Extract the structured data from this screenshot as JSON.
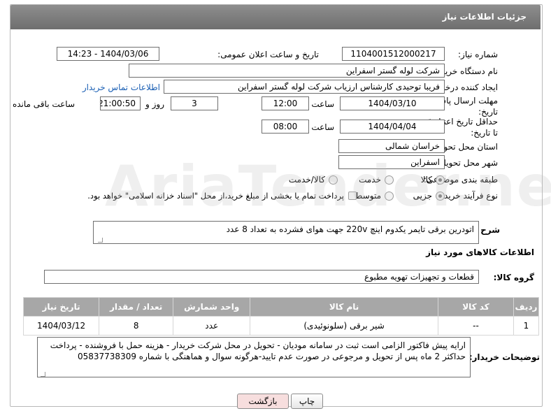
{
  "header": {
    "title": "جزئیات اطلاعات نیاز"
  },
  "form": {
    "need_number_label": "شماره نیاز:",
    "need_number": "1104001512000217",
    "announce_label": "تاریخ و ساعت اعلان عمومی:",
    "announce_value": "1404/03/06 - 14:23",
    "buyer_org_label": "نام دستگاه خریدار:",
    "buyer_org": "شرکت لوله گستر اسفراین",
    "creator_label": "ایجاد کننده درخواست:",
    "creator": "فریبا توحیدی کارشناس ارزیاب شرکت لوله گستر اسفراین",
    "contact_link": "اطلاعات تماس خریدار",
    "deadline_label_1": "مهلت ارسال پاسخ: تا",
    "deadline_label_2": "تاریخ:",
    "deadline_date": "1404/03/10",
    "time_label": "ساعت",
    "deadline_time": "12:00",
    "days_value": "3",
    "days_label": "روز و",
    "remaining_time": "21:00:50",
    "remaining_label": "ساعت باقی مانده",
    "min_validity_label_1": "حداقل تاریخ اعتبار قیمت:",
    "min_validity_label_2": "تا تاریخ:",
    "validity_date": "1404/04/04",
    "validity_time": "08:00",
    "province_label": "استان محل تحویل:",
    "province": "خراسان شمالی",
    "city_label": "شهر محل تحویل:",
    "city": "اسفراین",
    "category_label": "طبقه بندی موضوعی:",
    "category_options": [
      "کالا",
      "خدمت",
      "کالا/خدمت"
    ],
    "process_label": "نوع فرآیند خرید :",
    "process_options": [
      "جزیی",
      "متوسط"
    ],
    "payment_note": "پرداخت تمام یا بخشی از مبلغ خرید،از محل \"اسناد خزانه اسلامی\" خواهد بود."
  },
  "description": {
    "label": "شرح کلی نیاز:",
    "text": "اتودرین برقی تایمر یکدوم اینچ  220v جهت هوای فشرده به تعداد 8 عدد"
  },
  "goods_section": {
    "title": "اطلاعات کالاهای مورد نیاز",
    "group_label": "گروه کالا:",
    "group_value": "قطعات و تجهیزات تهویه مطبوع"
  },
  "table": {
    "headers": [
      "ردیف",
      "کد کالا",
      "نام کالا",
      "واحد شمارش",
      "تعداد / مقدار",
      "تاریخ نیاز"
    ],
    "rows": [
      [
        "1",
        "--",
        "شیر برقی (سلونوئیدی)",
        "عدد",
        "8",
        "1404/03/12"
      ]
    ]
  },
  "buyer_notes": {
    "label": "توضیحات خریدار:",
    "text": "ارایه پیش فاکتور الزامی است ثبت در سامانه مودیان - تحویل در محل شرکت خریدار - هزینه حمل با فروشنده - پرداخت حداکثر 2 ماه پس از تحویل و مرجوعی در صورت عدم تایید-هرگونه سوال و هماهنگی با شماره 05837738309"
  },
  "buttons": {
    "print": "چاپ",
    "back": "بازگشت"
  },
  "colors": {
    "header_bg": "#7d7d7d",
    "table_header_bg": "#a7a7a7",
    "link": "#1a5fb4",
    "back_btn_bg": "#f7dede"
  }
}
